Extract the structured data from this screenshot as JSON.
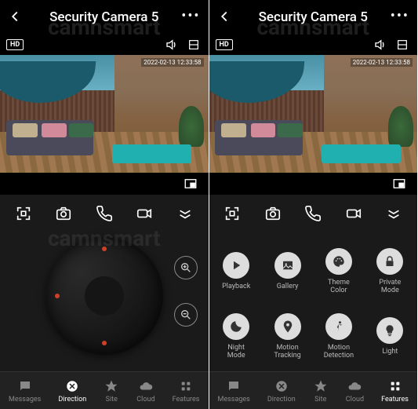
{
  "header": {
    "title": "Security Camera 5",
    "watermark": "camnsmart"
  },
  "video": {
    "hd_label": "HD",
    "timestamp": "2022-02-13 12:33:58"
  },
  "features": {
    "playback": "Playback",
    "gallery": "Gallery",
    "theme_color": "Theme\nColor",
    "private_mode": "Private\nMode",
    "night_mode": "Night\nMode",
    "motion_tracking": "Motion\nTracking",
    "motion_detection": "Motion\nDetection",
    "light": "Light"
  },
  "nav": {
    "messages": "Messages",
    "direction": "Direction",
    "site": "Site",
    "cloud": "Cloud",
    "features": "Features"
  }
}
